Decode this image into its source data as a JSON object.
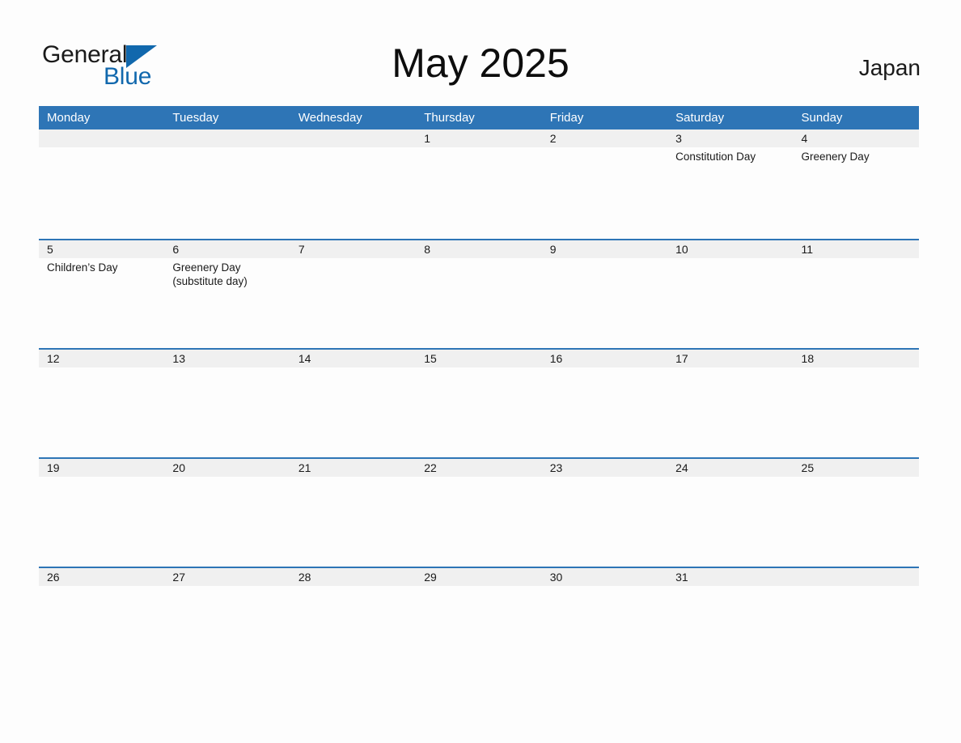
{
  "brand": {
    "word_top": "General",
    "word_bottom": "Blue",
    "triangle_color": "#1168ad",
    "text_color": "#1a1a1a",
    "icon": "general-blue-logo"
  },
  "header": {
    "title": "May 2025",
    "country": "Japan"
  },
  "theme": {
    "header_blue": "#2e75b6",
    "row_rule_blue": "#2e75b6",
    "number_band_gray": "#f0f0f0",
    "page_background": "#fdfdfd",
    "text_color": "#1a1a1a"
  },
  "calendar": {
    "month": "May",
    "year": "2025",
    "locale": "Japan",
    "week_start": "Monday",
    "day_headers": [
      "Monday",
      "Tuesday",
      "Wednesday",
      "Thursday",
      "Friday",
      "Saturday",
      "Sunday"
    ],
    "weeks": [
      {
        "cells": [
          {
            "day": "",
            "events": []
          },
          {
            "day": "",
            "events": []
          },
          {
            "day": "",
            "events": []
          },
          {
            "day": "1",
            "events": []
          },
          {
            "day": "2",
            "events": []
          },
          {
            "day": "3",
            "events": [
              "Constitution Day"
            ]
          },
          {
            "day": "4",
            "events": [
              "Greenery Day"
            ]
          }
        ]
      },
      {
        "cells": [
          {
            "day": "5",
            "events": [
              "Children’s Day"
            ]
          },
          {
            "day": "6",
            "events": [
              "Greenery Day",
              "(substitute day)"
            ]
          },
          {
            "day": "7",
            "events": []
          },
          {
            "day": "8",
            "events": []
          },
          {
            "day": "9",
            "events": []
          },
          {
            "day": "10",
            "events": []
          },
          {
            "day": "11",
            "events": []
          }
        ]
      },
      {
        "cells": [
          {
            "day": "12",
            "events": []
          },
          {
            "day": "13",
            "events": []
          },
          {
            "day": "14",
            "events": []
          },
          {
            "day": "15",
            "events": []
          },
          {
            "day": "16",
            "events": []
          },
          {
            "day": "17",
            "events": []
          },
          {
            "day": "18",
            "events": []
          }
        ]
      },
      {
        "cells": [
          {
            "day": "19",
            "events": []
          },
          {
            "day": "20",
            "events": []
          },
          {
            "day": "21",
            "events": []
          },
          {
            "day": "22",
            "events": []
          },
          {
            "day": "23",
            "events": []
          },
          {
            "day": "24",
            "events": []
          },
          {
            "day": "25",
            "events": []
          }
        ]
      },
      {
        "cells": [
          {
            "day": "26",
            "events": []
          },
          {
            "day": "27",
            "events": []
          },
          {
            "day": "28",
            "events": []
          },
          {
            "day": "29",
            "events": []
          },
          {
            "day": "30",
            "events": []
          },
          {
            "day": "31",
            "events": []
          },
          {
            "day": "",
            "events": []
          }
        ]
      }
    ],
    "holidays": [
      {
        "date": "3",
        "name": "Constitution Day"
      },
      {
        "date": "4",
        "name": "Greenery Day"
      },
      {
        "date": "5",
        "name": "Children’s Day"
      },
      {
        "date": "6",
        "name": "Greenery Day (substitute day)"
      }
    ]
  }
}
